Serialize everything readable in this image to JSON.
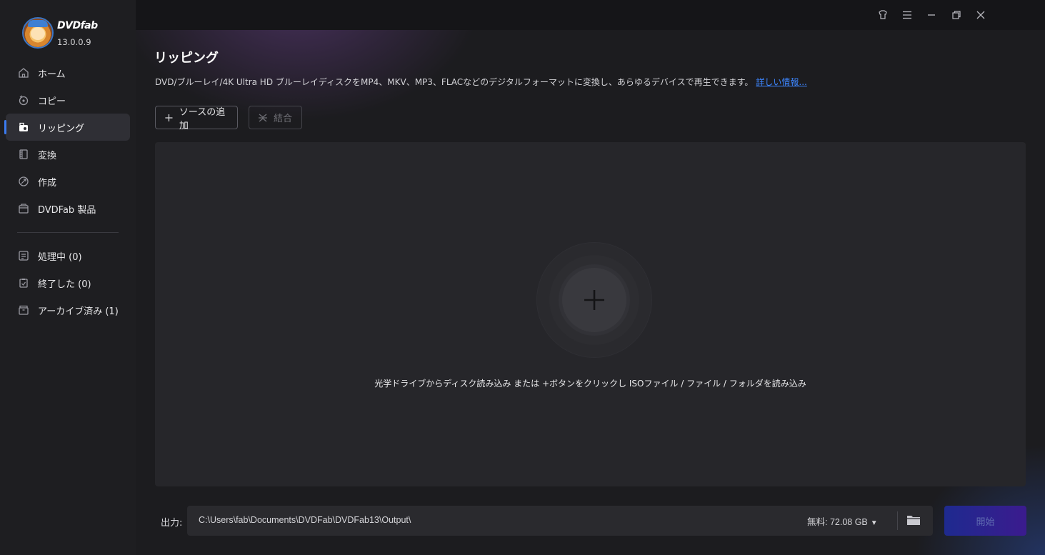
{
  "app": {
    "brand_name": "DVDfab",
    "version": "13.0.0.9"
  },
  "sidebar": {
    "items": [
      {
        "label": "ホーム",
        "icon": "home-icon"
      },
      {
        "label": "コピー",
        "icon": "copy-icon"
      },
      {
        "label": "リッピング",
        "icon": "ripper-icon",
        "active": true
      },
      {
        "label": "変換",
        "icon": "converter-icon"
      },
      {
        "label": "作成",
        "icon": "creator-icon"
      },
      {
        "label": "DVDFab 製品",
        "icon": "products-icon"
      }
    ],
    "queue_items": [
      {
        "label": "処理中 (0)",
        "icon": "processing-icon"
      },
      {
        "label": "終了した (0)",
        "icon": "finished-icon"
      },
      {
        "label": "アーカイブ済み (1)",
        "icon": "archive-icon"
      }
    ]
  },
  "titlebar": {
    "buttons": [
      "skin-icon",
      "menu-icon",
      "minimize-icon",
      "restore-icon",
      "close-icon"
    ]
  },
  "main": {
    "title": "リッピング",
    "description": "DVD/ブルーレイ/4K Ultra HD ブルーレイディスクをMP4、MKV、MP3、FLACなどのデジタルフォーマットに変換し、あらゆるデバイスで再生できます。",
    "more_link": "詳しい情報...",
    "add_source_label": "ソースの追加",
    "merge_label": "結合",
    "drop_hint": "光学ドライブからディスク読み込み または +ボタンをクリックし ISOファイル / ファイル / フォルダを読み込み"
  },
  "output": {
    "label": "出力:",
    "path": "C:\\Users\\fab\\Documents\\DVDFab\\DVDFab13\\Output\\",
    "free_space": "無料: 72.08 GB",
    "start_label": "開始"
  },
  "colors": {
    "accent": "#3b7bf0",
    "link": "#3d86ff",
    "start_gradient_from": "#1e2a8f",
    "start_gradient_to": "#3b1b8e"
  }
}
